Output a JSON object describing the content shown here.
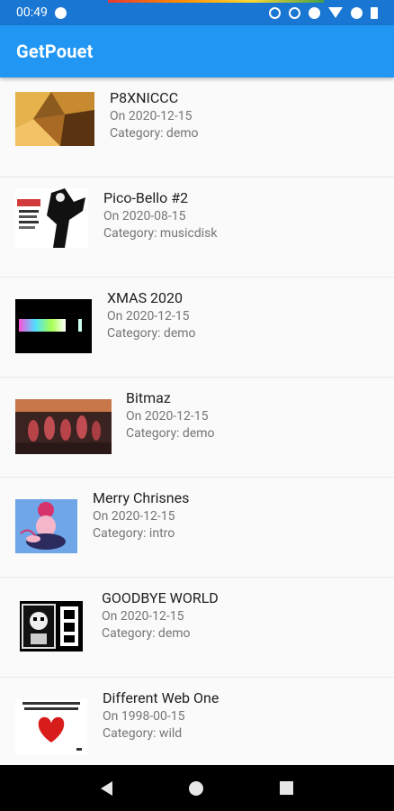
{
  "status": {
    "time": "00:49"
  },
  "app": {
    "title": "GetPouet"
  },
  "prods": [
    {
      "name": "P8XNICCC",
      "date": "On 2020-12-15",
      "category": "Category: demo",
      "thumb_icon": "p8xniccc-screenshot"
    },
    {
      "name": "Pico-Bello #2",
      "date": "On 2020-08-15",
      "category": "Category: musicdisk",
      "thumb_icon": "pico-bello-screenshot"
    },
    {
      "name": "XMAS 2020",
      "date": "On 2020-12-15",
      "category": "Category: demo",
      "thumb_icon": "xmas-2020-screenshot"
    },
    {
      "name": "Bitmaz",
      "date": "On 2020-12-15",
      "category": "Category: demo",
      "thumb_icon": "bitmaz-screenshot"
    },
    {
      "name": "Merry Chrisnes",
      "date": "On 2020-12-15",
      "category": "Category: intro",
      "thumb_icon": "merry-chrisnes-screenshot"
    },
    {
      "name": "GOODBYE WORLD",
      "date": "On 2020-12-15",
      "category": "Category: demo",
      "thumb_icon": "goodbye-world-screenshot"
    },
    {
      "name": "Different Web One",
      "date": "On 1998-00-15",
      "category": "Category: wild",
      "thumb_icon": "different-web-one-screenshot"
    }
  ],
  "colors": {
    "app_bar": "#2196f3",
    "status_bar": "#1976d2"
  },
  "nav": {
    "back_icon": "back-icon",
    "home_icon": "home-icon",
    "recents_icon": "recents-icon"
  }
}
